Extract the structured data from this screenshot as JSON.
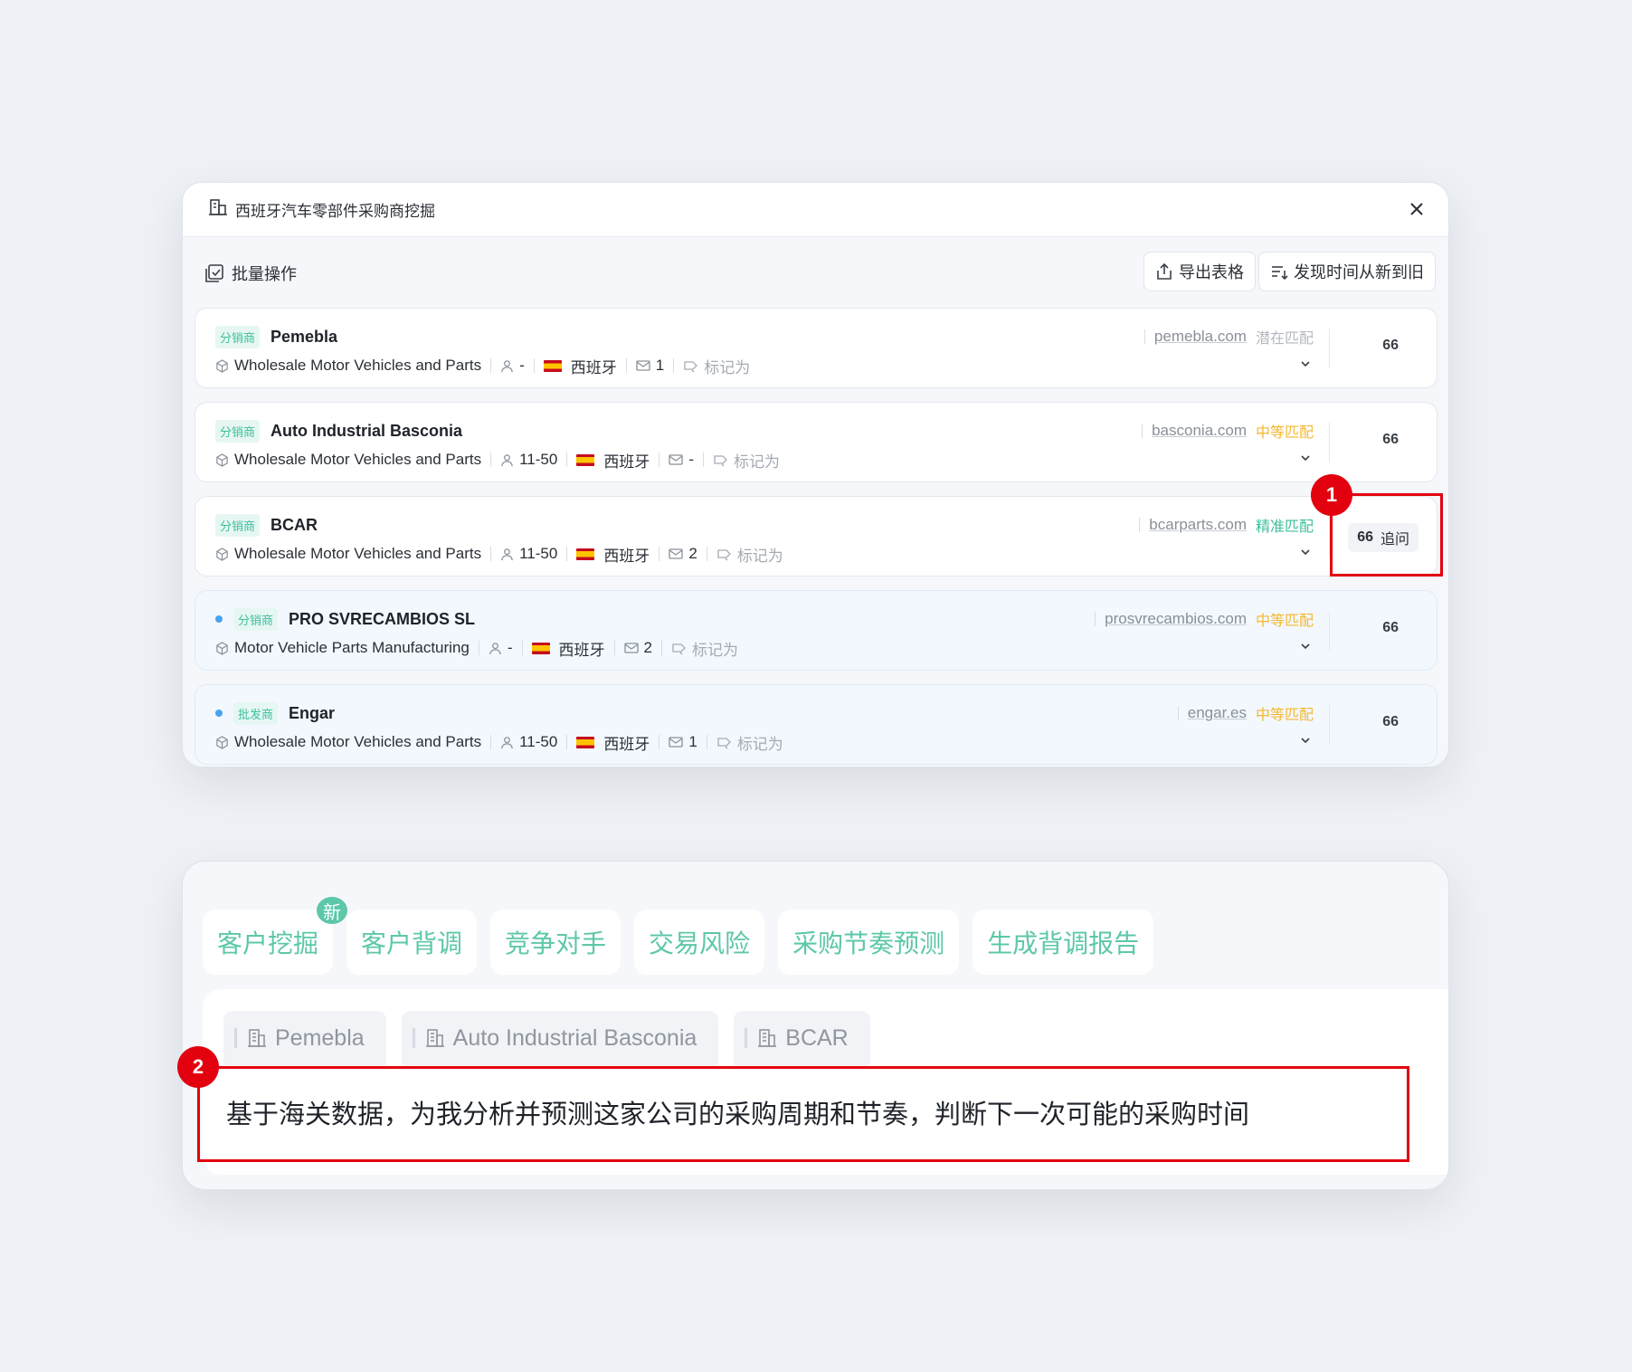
{
  "panel1": {
    "title": "西班牙汽车零部件采购商挖掘",
    "batch_label": "批量操作",
    "export_label": "导出表格",
    "sort_label": "发现时间从新到旧",
    "mark_label": "标记为",
    "quote_glyph": "66",
    "followup_label": "追问",
    "cards": [
      {
        "tag": "分销商",
        "name": "Pemebla",
        "industry": "Wholesale Motor Vehicles and Parts",
        "employees": "-",
        "country": "西班牙",
        "emails": "1",
        "domain": "pemebla.com",
        "match": "潜在匹配",
        "match_color": "#b4b8bf",
        "new": false
      },
      {
        "tag": "分销商",
        "name": "Auto Industrial Basconia",
        "industry": "Wholesale Motor Vehicles and Parts",
        "employees": "11-50",
        "country": "西班牙",
        "emails": "-",
        "domain": "basconia.com",
        "match": "中等匹配",
        "match_color": "#f5b731",
        "new": false
      },
      {
        "tag": "分销商",
        "name": "BCAR",
        "industry": "Wholesale Motor Vehicles and Parts",
        "employees": "11-50",
        "country": "西班牙",
        "emails": "2",
        "domain": "bcarparts.com",
        "match": "精准匹配",
        "match_color": "#3cbf9c",
        "new": false
      },
      {
        "tag": "分销商",
        "name": "PRO SVRECAMBIOS SL",
        "industry": "Motor Vehicle Parts Manufacturing",
        "employees": "-",
        "country": "西班牙",
        "emails": "2",
        "domain": "prosvrecambios.com",
        "match": "中等匹配",
        "match_color": "#f5b731",
        "new": true
      },
      {
        "tag": "批发商",
        "name": "Engar",
        "industry": "Wholesale Motor Vehicles and Parts",
        "employees": "11-50",
        "country": "西班牙",
        "emails": "1",
        "domain": "engar.es",
        "match": "中等匹配",
        "match_color": "#f5b731",
        "new": true
      }
    ]
  },
  "annotations": {
    "badge1": "1",
    "badge2": "2"
  },
  "panel2": {
    "tabs": [
      "客户挖掘",
      "客户背调",
      "竞争对手",
      "交易风险",
      "采购节奏预测",
      "生成背调报告"
    ],
    "new_badge": "新",
    "company_chips": [
      "Pemebla",
      "Auto Industrial Basconia",
      "BCAR"
    ],
    "prompt_text": "基于海关数据，为我分析并预测这家公司的采购周期和节奏，判断下一次可能的采购时间"
  },
  "colors": {
    "accent_green": "#5dc7a9",
    "annotation_red": "#e3000f",
    "new_dot": "#4aa3f0"
  }
}
